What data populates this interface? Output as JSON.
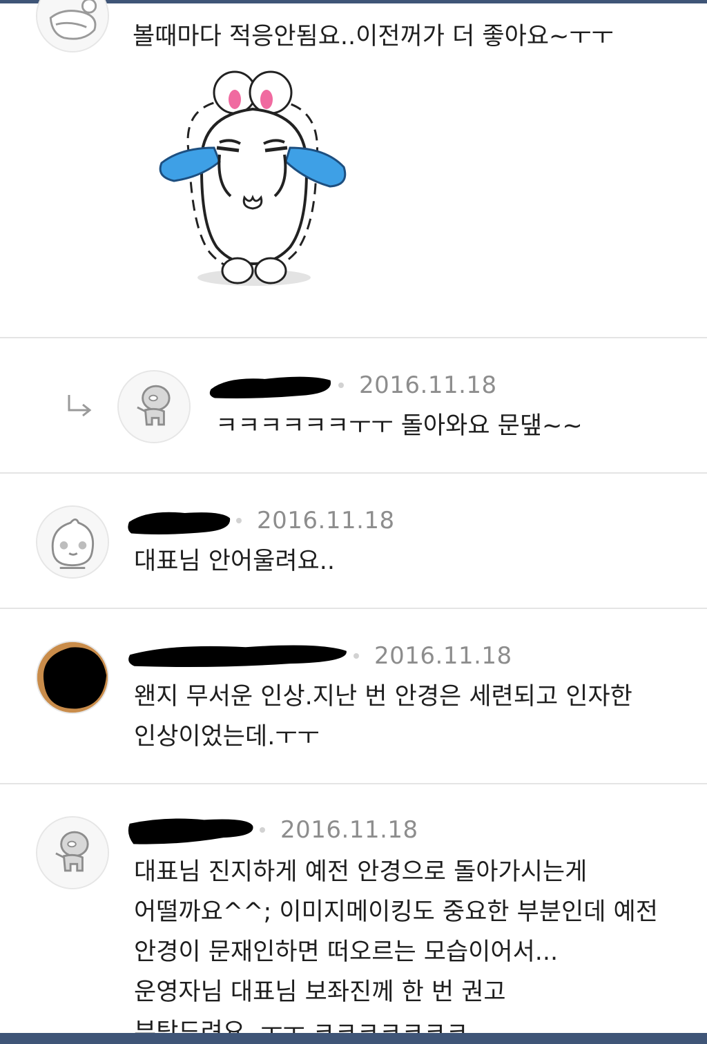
{
  "colors": {
    "top_bar": "#3f5577",
    "divider": "#e4e4e4",
    "date_text": "#8d8d8d",
    "body_text": "#1e1e1e",
    "tear_blue": "#3ea0e6",
    "ear_pink": "#f06aa0"
  },
  "comments": [
    {
      "author": "",
      "date": "",
      "text": "볼때마다 적응안됨요..이전꺼가 더 좋아요~ㅜㅜ",
      "avatar_icon": "hand-character-avatar-icon",
      "sticker_icon": "crying-rabbit-sticker-icon"
    },
    {
      "author": "",
      "date": "2016.11.18",
      "text": "ㅋㅋㅋㅋㅋㅋㅜㅜ 돌아와요 문댚~~",
      "is_reply": true,
      "reply_icon": "reply-arrow-icon",
      "avatar_icon": "grey-character-avatar-icon"
    },
    {
      "author": "",
      "date": "2016.11.18",
      "text": "대표님 안어울려요..",
      "avatar_icon": "peach-character-avatar-icon"
    },
    {
      "author": "",
      "date": "2016.11.18",
      "text": "왠지 무서운 인상.지난 번 안경은 세련되고 인자한\n인상이었는데.ㅜㅜ",
      "avatar_icon": "photo-avatar-icon"
    },
    {
      "author": "",
      "date": "2016.11.18",
      "text": "대표님 진지하게 예전 안경으로 돌아가시는게\n어떨까요^^; 이미지메이킹도 중요한 부분인데 예전\n안경이 문재인하면 떠오르는 모습이어서...\n운영자님 대표님 보좌진께 한 번 권고\n부탁드려요..ㅜㅜ ㅋㅋㅋㅋㅋㅋㅋ",
      "avatar_icon": "grey-character-avatar-icon"
    }
  ]
}
